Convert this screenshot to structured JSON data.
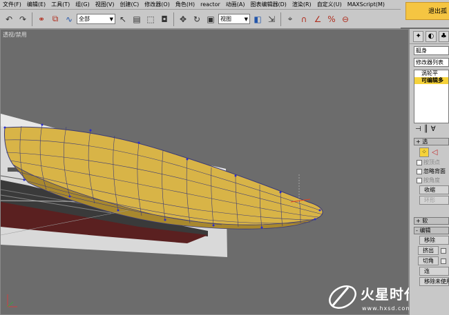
{
  "menubar": {
    "items": [
      "文件(F)",
      "编辑(E)",
      "工具(T)",
      "组(G)",
      "视图(V)",
      "创建(C)",
      "修改器(O)",
      "角色(H)",
      "reactor",
      "动画(A)",
      "图表编辑器(D)",
      "渲染(R)",
      "自定义(U)",
      "MAXScript(M)"
    ]
  },
  "exit": {
    "label": "退出孤"
  },
  "toolbar": {
    "selection_filter": "全部",
    "ref_coord": "视图"
  },
  "viewport": {
    "label": "透视/禁用"
  },
  "command_panel": {
    "object_name": "艇身",
    "modifier_list": "修改器列表",
    "stack": [
      "涡轮平",
      "可编辑多"
    ],
    "selection_rollout": "选",
    "by_vertex": "按顶点",
    "ignore_backfacing": "忽略背面",
    "by_angle": "按角度",
    "shrink": "收缩",
    "ring": "环形",
    "soft_selection_rollout": "软",
    "edit_rollout": "编辑",
    "remove": "移除",
    "extrude": "挤出",
    "chamfer": "切角",
    "connect": "连",
    "remove_unused": "移除未使用"
  },
  "watermark": {
    "main": "火星时代",
    "url": "www.hxsd.com"
  },
  "colors": {
    "hull": "#d8b447",
    "wire": "#3a3a78",
    "selection": "#f5d23a"
  }
}
